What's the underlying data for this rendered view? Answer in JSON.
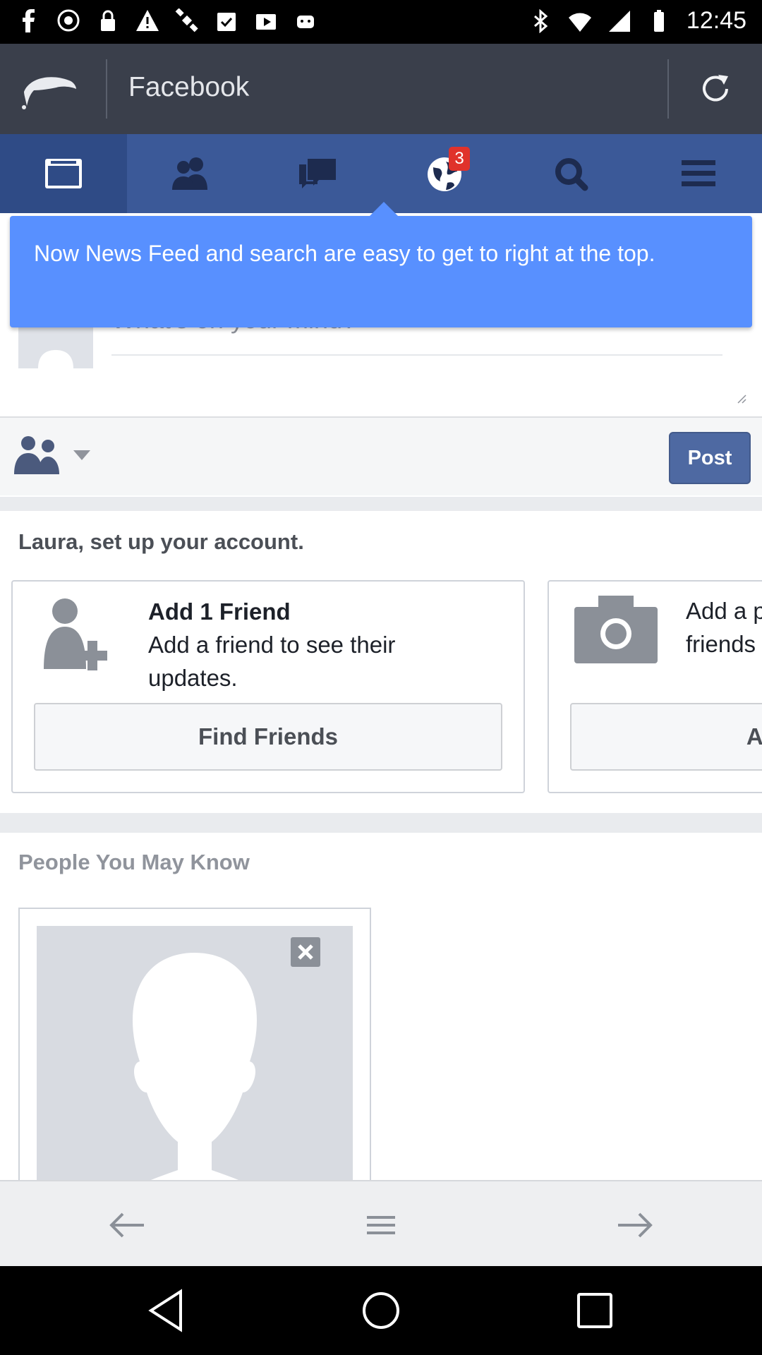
{
  "status_bar": {
    "time": "12:45",
    "icons": [
      "facebook-icon",
      "sync-icon",
      "lock-icon",
      "warning-icon",
      "satellite-icon",
      "clipboard-check-icon",
      "play-store-icon",
      "android-icon",
      "bluetooth-icon",
      "wifi-icon",
      "signal-icon",
      "battery-icon"
    ]
  },
  "browser": {
    "title": "Facebook"
  },
  "fb_nav": {
    "tabs": [
      "news-feed",
      "friends",
      "messages",
      "notifications",
      "search",
      "menu"
    ],
    "notifications_badge": "3",
    "active_tab": "news-feed"
  },
  "tooltip": {
    "text": "Now News Feed and search are easy to get to right at the top."
  },
  "composer": {
    "placeholder": "What's on your mind?",
    "post_label": "Post"
  },
  "setup": {
    "title": "Laura, set up your account.",
    "cards": [
      {
        "heading": "Add 1 Friend",
        "body": "Add a friend to see their updates.",
        "button": "Find Friends"
      },
      {
        "heading": "",
        "body": "Add a p friends",
        "button": "Ac"
      }
    ]
  },
  "pymk": {
    "title": "People You May Know"
  },
  "colors": {
    "fb_blue": "#3b5998",
    "tooltip_blue": "#5890ff",
    "browser_bar": "#3a3f4b"
  }
}
